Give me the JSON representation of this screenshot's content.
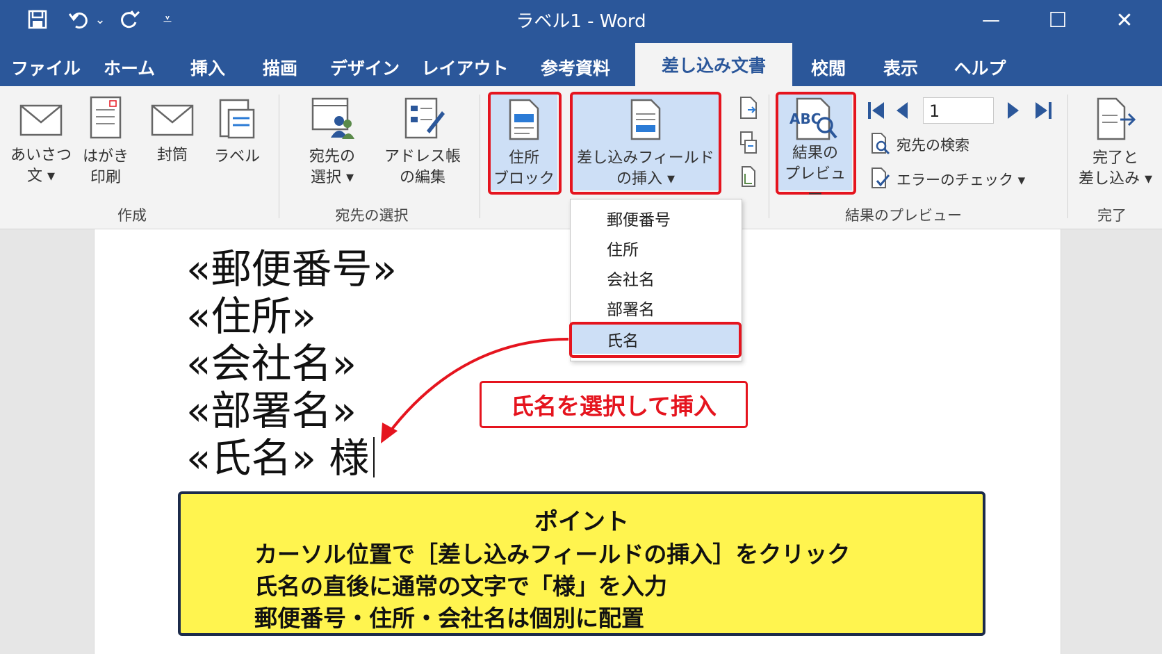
{
  "window": {
    "title": "ラベル1  -  Word",
    "quick_access": {
      "save_icon": "save-icon",
      "undo_icon": "undo-icon",
      "undo_dropdown": "⌄",
      "redo_icon": "redo-icon",
      "customize": "⩡"
    },
    "controls": {
      "minimize": "—",
      "maximize": "☐",
      "close": "✕"
    }
  },
  "tabs": [
    "ファイル",
    "ホーム",
    "挿入",
    "描画",
    "デザイン",
    "レイアウト",
    "参考資料",
    "差し込み文書",
    "校閲",
    "表示",
    "ヘルプ"
  ],
  "active_tab": "差し込み文書",
  "ribbon": {
    "groups": [
      {
        "label": "作成",
        "buttons": [
          "あいさつ\n文 ▾",
          "はがき\n印刷",
          "封筒",
          "ラベル"
        ]
      },
      {
        "label": "宛先の選択",
        "buttons": [
          "宛先の\n選択 ▾",
          "アドレス帳\nの編集"
        ]
      },
      {
        "label": "",
        "buttons": [
          "住所\nブロック",
          "差し込みフィールド\nの挿入 ▾"
        ]
      },
      {
        "label": "結果のプレビュー",
        "buttons": [
          "結果の\nプレビュー"
        ]
      },
      {
        "label": "完了",
        "buttons": [
          "完了と\n差し込み ▾"
        ]
      }
    ],
    "preview_record": "1",
    "find_recipient": "宛先の検索",
    "check_errors": "エラーのチェック ▾",
    "preview_abc": "ABC",
    "highlighted_buttons": [
      "住所ブロック",
      "差し込みフィールドの挿入",
      "結果のプレビュー"
    ]
  },
  "dropdown": {
    "items": [
      "郵便番号",
      "住所",
      "会社名",
      "部署名",
      "氏名"
    ],
    "selected": "氏名"
  },
  "document": {
    "fields": [
      "«郵便番号»",
      "«住所»",
      "«会社名»",
      "«部署名»",
      "«氏名» 様"
    ]
  },
  "callout": {
    "text": "氏名を選択して挿入"
  },
  "point": {
    "title": "ポイント",
    "lines": [
      "カーソル位置で［差し込みフィールドの挿入］をクリック",
      "氏名の直後に通常の文字で「様」を入力",
      "郵便番号・住所・会社名は個別に配置"
    ]
  },
  "colors": {
    "accent": "#2b579a",
    "highlight_red": "#e5141e",
    "point_bg": "#fff44f",
    "selected_bg": "#cddff6"
  }
}
